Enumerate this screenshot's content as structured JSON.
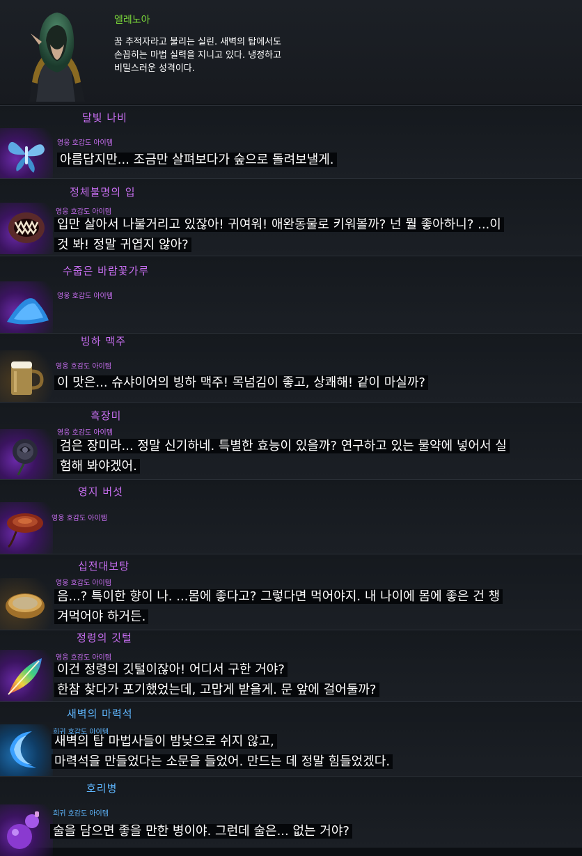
{
  "character": {
    "name": "엘레노아",
    "description": "꿈 추적자라고 불리는 실린. 새벽의 탑에서도\n손꼽히는 마법 실력을 지니고 있다. 냉정하고\n비밀스러운 성격이다."
  },
  "items": [
    {
      "title": "달빛 나비",
      "grade": "영웅 호감도 아이템",
      "icon": "moonlight-butterfly-icon",
      "lines": [
        "아름답지만... 조금만 살펴보다가 숲으로 돌려보낼게."
      ]
    },
    {
      "title": "정체불명의 입",
      "grade": "영웅 호감도 아이템",
      "icon": "mysterious-mouth-icon",
      "lines": [
        "입만 살아서 나불거리고 있잖아! 귀여워! 애완동물로 키워볼까? 넌 뭘 좋아하니? ...이",
        "것 봐! 정말 귀엽지 않아?"
      ]
    },
    {
      "title": "수줍은 바람꽃가루",
      "grade": "영웅 호감도 아이템",
      "icon": "anemone-powder-icon",
      "lines": []
    },
    {
      "title": "빙하 맥주",
      "grade": "영웅 호감도 아이템",
      "icon": "beer-mug-icon",
      "lines": [
        "이 맛은... 슈샤이어의 빙하 맥주! 목넘김이 좋고, 상쾌해! 같이 마실까?"
      ]
    },
    {
      "title": "흑장미",
      "grade": "영웅 호감도 아이템",
      "icon": "black-rose-icon",
      "lines": [
        "검은 장미라... 정말 신기하네. 특별한 효능이 있을까? 연구하고 있는 물약에 넣어서 실",
        "험해 봐야겠어."
      ]
    },
    {
      "title": "영지 버섯",
      "grade": "영웅 호감도 아이템",
      "icon": "reishi-mushroom-icon",
      "lines": []
    },
    {
      "title": "십전대보탕",
      "grade": "영웅 호감도 아이템",
      "icon": "herbal-soup-icon",
      "lines": [
        "음...? 특이한 향이 나. ...몸에 좋다고? 그렇다면 먹어야지. 내 나이에 몸에 좋은 건 챙",
        "겨먹어야 하거든."
      ]
    },
    {
      "title": "정령의 깃털",
      "grade": "영웅 호감도 아이템",
      "icon": "spirit-feather-icon",
      "lines": [
        "이건 정령의 깃털이잖아! 어디서 구한 거야?",
        "한참 찾다가 포기했었는데, 고맙게 받을게. 문 앞에 걸어둘까?"
      ]
    },
    {
      "title": "새벽의 마력석",
      "grade": "희귀 호감도 아이템",
      "icon": "crescent-mana-stone-icon",
      "lines": [
        "새벽의 탑 마법사들이 밤낮으로 쉬지 않고,",
        "마력석을 만들었다는 소문을 들었어. 만드는 데 정말 힘들었겠다."
      ]
    },
    {
      "title": "호리병",
      "grade": "희귀 호감도 아이템",
      "icon": "gourd-bottle-icon",
      "lines": [
        "술을 담으면 좋을 만한 병이야. 그런데 술은... 없는 거야?"
      ]
    }
  ]
}
